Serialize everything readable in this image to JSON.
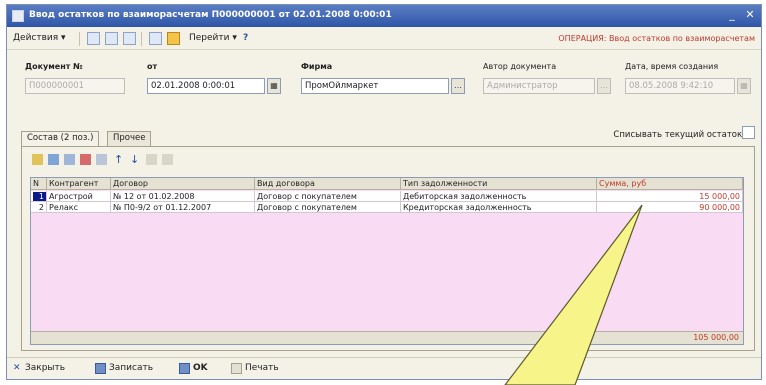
{
  "window": {
    "title": "Ввод остатков по взаиморасчетам П000000001 от 02.01.2008 0:00:01",
    "minimize": "_",
    "close": "✕"
  },
  "toolbar": {
    "actions": "Действия ▾",
    "goto": "Перейти ▾",
    "help": "?",
    "operation": "ОПЕРАЦИЯ: Ввод остатков по взаиморасчетам"
  },
  "header": {
    "doc_number_label": "Документ №",
    "doc_number_value": "П000000001",
    "date_label": "от",
    "date_value": "02.01.2008  0:00:01",
    "firm_label": "Фирма",
    "firm_value": "ПромОйлмаркет",
    "author_label": "Автор документа",
    "author_value": "Администратор",
    "created_label": "Дата, время создания",
    "created_value": "08.05.2008  9:42:10"
  },
  "tabs": [
    {
      "label": "Состав (2 поз.)"
    },
    {
      "label": "Прочее"
    }
  ],
  "write_off_label": "Списывать текущий остаток:",
  "table": {
    "columns": [
      "N",
      "Контрагент",
      "Договор",
      "Вид договора",
      "Тип задолженности",
      "Сумма, руб"
    ],
    "rows": [
      {
        "n": "1",
        "counterparty": "Агрострой",
        "contract": "№ 12 от 01.02.2008",
        "contract_type": "Договор с покупателем",
        "debt_type": "Дебиторская задолженность",
        "amount": "15 000,00"
      },
      {
        "n": "2",
        "counterparty": "Релакс",
        "contract": "№ П0-9/2 от 01.12.2007",
        "contract_type": "Договор с покупателем",
        "debt_type": "Кредиторская задолженность",
        "amount": "90 000,00"
      }
    ],
    "total": "105 000,00"
  },
  "bottom": {
    "close": "Закрыть",
    "save": "Записать",
    "ok": "OK",
    "print": "Печать"
  },
  "colors": {
    "title_bar": "#3a63b4",
    "grid_background": "#f9dcf3",
    "amount_text": "#c0392b",
    "callout_fill": "#f7f48a"
  }
}
